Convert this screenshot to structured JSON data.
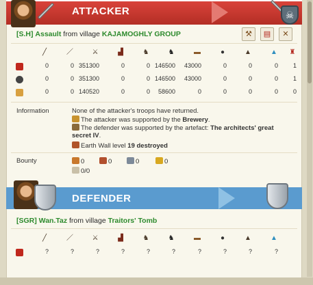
{
  "attacker": {
    "title": "ATTACKER",
    "tribe_tag": "[S.H]",
    "player": "Assault",
    "from_text": "from village",
    "village": "KAJAMOGHLY GROUP",
    "tools": [
      "hammer-icon",
      "report-icon",
      "swords-icon"
    ],
    "unit_icons": [
      "club-icon",
      "spear-icon",
      "axe-icon",
      "boot-icon",
      "horse-icon",
      "dark-horse-icon",
      "ram-icon",
      "catapult-icon",
      "helmet-icon",
      "wizard-hat-icon",
      "chief-icon"
    ],
    "rows": [
      {
        "icon": "red-shield-icon",
        "values": [
          "0",
          "0",
          "351300",
          "0",
          "0",
          "146500",
          "43000",
          "0",
          "0",
          "0",
          "1"
        ]
      },
      {
        "icon": "skull-icon",
        "values": [
          "0",
          "0",
          "351300",
          "0",
          "0",
          "146500",
          "43000",
          "0",
          "0",
          "0",
          "1"
        ]
      },
      {
        "icon": "crossed-icon",
        "values": [
          "0",
          "0",
          "140520",
          "0",
          "0",
          "58600",
          "0",
          "0",
          "0",
          "0",
          "0"
        ]
      }
    ]
  },
  "information": {
    "label": "Information",
    "line1": "None of the attacker's troops have returned.",
    "line2_pre": "The attacker was supported by the ",
    "line2_bold": "Brewery",
    "line2_post": ".",
    "line3_pre": "The defender was supported by the artefact: ",
    "line3_bold1": "The architects' great",
    "line3_bold2": "secret IV",
    "line3_post": ".",
    "line4_pre": "Earth Wall level ",
    "line4_bold": "19 destroyed"
  },
  "bounty": {
    "label": "Bounty",
    "items": [
      {
        "icon": "wood-icon",
        "value": "0"
      },
      {
        "icon": "clay-icon",
        "value": "0"
      },
      {
        "icon": "iron-icon",
        "value": "0"
      },
      {
        "icon": "crop-icon",
        "value": "0"
      }
    ],
    "carry": "0/0"
  },
  "defender": {
    "title": "DEFENDER",
    "tribe_tag": "[SGR]",
    "player": "Wan.Taz",
    "from_text": "from village",
    "village": "Traitors' Tomb",
    "unit_icons": [
      "club-icon",
      "spear-icon",
      "axe-icon",
      "boot-icon",
      "horse-icon",
      "dark-horse-icon",
      "ram-icon",
      "catapult-icon",
      "helmet-icon",
      "wizard-hat-icon"
    ],
    "row": {
      "icon": "red-shield-icon",
      "values": [
        "?",
        "?",
        "?",
        "?",
        "?",
        "?",
        "?",
        "?",
        "?",
        "?"
      ]
    }
  },
  "colors": {
    "attacker_bar": "#c53a30",
    "defender_bar": "#5a9bcf",
    "tag_green": "#2d8a2d"
  }
}
